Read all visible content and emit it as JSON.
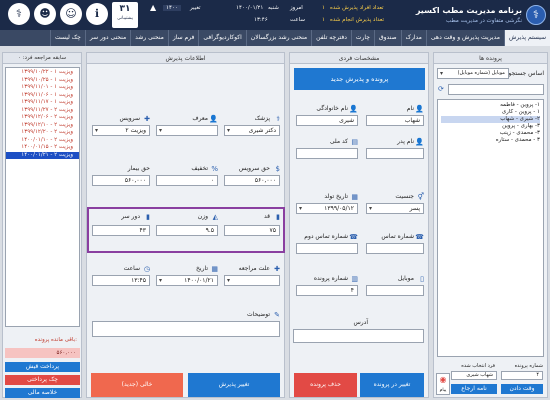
{
  "header": {
    "app_title": "برنامه مدیریت مطب اکسیر",
    "app_subtitle": "نگرشی متفاوت در مدیریت مطب",
    "stat1_label": "تعداد افراد پذیرش شده",
    "stat1_value": "۱",
    "stat2_label": "تعداد پذیرش انجام شده",
    "stat2_value": "۱",
    "today_label": "امروز",
    "today_date": "۱۴۰۰/۰۱/۲۱",
    "today_day": "شنبه",
    "time_label": "ساعت",
    "time_value": "۱۳:۴۶",
    "change_label": "تغییر",
    "change_value": "۱۴۰۰",
    "calendar_day": "۳۱",
    "calendar_text": "پشتیبانی",
    "top_icons": [
      "info-icon",
      "user-icon",
      "group-icon",
      "doctor-icon"
    ]
  },
  "menu": [
    {
      "label": "سیستم پذیرش",
      "active": true
    },
    {
      "label": "مدیریت پذیرش و وقت دهی",
      "active": false
    },
    {
      "label": "مدارک",
      "active": false
    },
    {
      "label": "صندوق",
      "active": false
    },
    {
      "label": "چارت",
      "active": false
    },
    {
      "label": "دفترچه تلفن",
      "active": false
    },
    {
      "label": "منحنی رشد بزرگسالان",
      "active": false
    },
    {
      "label": "اکوکاردیوگرافی",
      "active": false
    },
    {
      "label": "فرم ساز",
      "active": false
    },
    {
      "label": "منحنی رشد",
      "active": false
    },
    {
      "label": "منحنی دور سر",
      "active": false
    },
    {
      "label": "چک لیست",
      "active": false
    }
  ],
  "sidebar": {
    "title": "پرونده ها",
    "search_label": "اساس جستجو",
    "search_value": "موبایل (شماره موبایل)",
    "tree": [
      {
        "label": "۱- پروین - فاطمه",
        "selected": false
      },
      {
        "label": "۱ - پروین - کاری",
        "selected": false
      },
      {
        "label": "۲- شیری - شهاب",
        "selected": true
      },
      {
        "label": "۳- بهاری - پروین",
        "selected": false
      },
      {
        "label": "۳- محمدی - زینب",
        "selected": false
      },
      {
        "label": "۳ - محمدی - ستاره",
        "selected": false
      }
    ],
    "record_no_label": "شماره پرونده",
    "record_no_value": "۴",
    "fullname_label": "فرد انتخاب شده",
    "fullname_value": "شهاب شیری",
    "btn_appointment": "وقت دادن",
    "btn_letter": "نامه ارجاع",
    "btn_message": "پیام"
  },
  "personal": {
    "title": "مشخصات فردی",
    "new_record_btn": "پرونده و پذیرش جدید",
    "name_label": "نام",
    "name_value": "شهاب",
    "family_label": "نام خانوادگی",
    "family_value": "شیری",
    "father_label": "نام پدر",
    "father_value": "",
    "national_label": "کد ملی",
    "national_value": "",
    "gender_label": "جنسیت",
    "gender_value": "پسر",
    "birth_label": "تاریخ تولد",
    "birth_value": "۱۳۹۹/۰۵/۱۲",
    "phone_label": "شماره تماس",
    "phone_value": "",
    "phone2_label": "شماره تماس دوم",
    "phone2_value": "",
    "mobile_label": "موبایل",
    "mobile_value": "",
    "record_label": "شماره پرونده",
    "record_value": "۴",
    "address_label": "آدرس",
    "address_value": "",
    "btn_edit": "تغییر در پرونده",
    "btn_delete": "حذف پرونده"
  },
  "reception": {
    "title": "اطلاعات پذیرش",
    "doctor_label": "پزشک",
    "doctor_value": "دکتر شیری",
    "referrer_label": "معرف",
    "referrer_value": "",
    "service_label": "سرویس",
    "service_value": "ویزیت ۲",
    "service_fee_label": "حق سرویس",
    "service_fee_value": "۵۶۰,۰۰۰",
    "discount_label": "تخفیف",
    "discount_value": "۰",
    "patient_fee_label": "حق بیمار",
    "patient_fee_value": "۵۶۰,۰۰۰",
    "height_label": "قد",
    "height_value": "۷۵",
    "weight_label": "وزن",
    "weight_value": "۹.۵",
    "head_label": "دور سر",
    "head_value": "۴۳",
    "reason_label": "علت مراجعه",
    "reason_value": "",
    "date_label": "تاریخ",
    "date_value": "۱۴۰۰/۰۱/۲۱",
    "time_label": "ساعت",
    "time_value": "۱۳:۴۵",
    "notes_label": "توضیحات",
    "notes_value": "",
    "btn_change": "تغییر پذیرش",
    "btn_empty": "خالی (جدید)"
  },
  "history": {
    "title": "سابقه مراجعه فرد: ۰",
    "rows": [
      {
        "label": "۱۳۹۹/۱۰/۲۲ - ویزیت ۱",
        "selected": false
      },
      {
        "label": "۱۳۹۹/۱۰/۲۵ - ویزیت ۱",
        "selected": false
      },
      {
        "label": "۱۳۹۹/۱۱/۰۱ - ویزیت ۱",
        "selected": false
      },
      {
        "label": "۱۳۹۹/۱۱/۰۶ - ویزیت ۱",
        "selected": false
      },
      {
        "label": "۱۳۹۹/۱۱/۱۷ - ویزیت ۱",
        "selected": false
      },
      {
        "label": "۱۳۹۹/۱۱/۲۷ - ویزیت ۲",
        "selected": false
      },
      {
        "label": "۱۳۹۹/۱۲/۰۶ - ویزیت ۲",
        "selected": false
      },
      {
        "label": "۱۳۹۹/۱۲/۱۰ - ویزیت ۲",
        "selected": false
      },
      {
        "label": "۱۳۹۹/۱۲/۲۰ - ویزیت ۲",
        "selected": false
      },
      {
        "label": "۱۴۰۰/۰۱/۱۰ - ویزیت ۲",
        "selected": false
      },
      {
        "label": "۱۴۰۰/۰۱/۱۵ - ویزیت ۲",
        "selected": false
      },
      {
        "label": "۱۴۰۰/۰۱/۲۱ - ویزیت ۲",
        "selected": true
      }
    ],
    "remaining_label": "باقی مانده پرونده:",
    "remaining_value": "۵۶۰,۰۰۰",
    "btn_receive": "پرداخت قیش",
    "btn_print": "چک پرداختی",
    "btn_summary": "خلاصه مالی"
  }
}
